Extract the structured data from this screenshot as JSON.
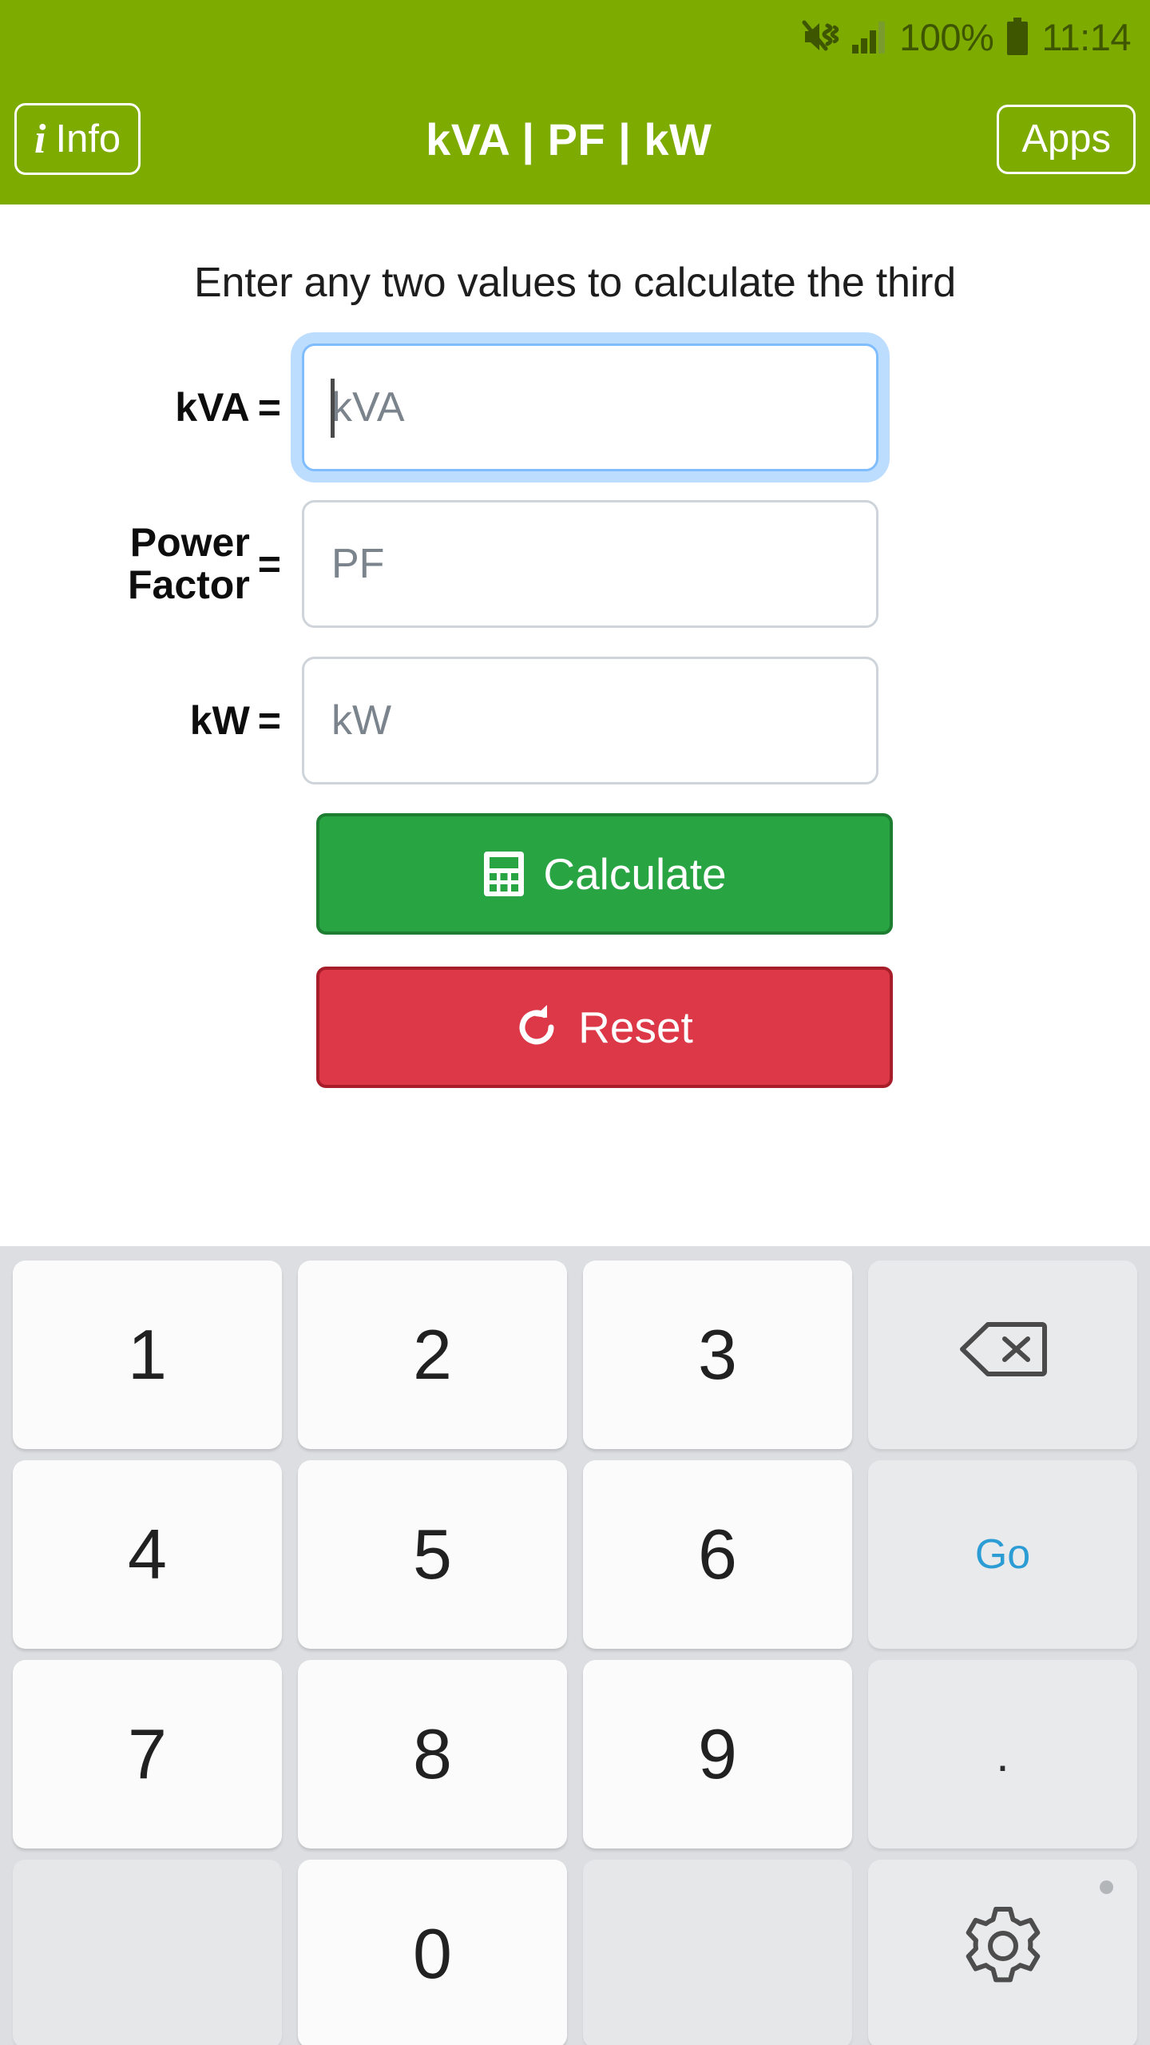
{
  "statusbar": {
    "mute_icon": "mute-vibrate-icon",
    "signal_icon": "signal-bars-icon",
    "battery_percent": "100%",
    "battery_icon": "battery-full-icon",
    "clock": "11:14"
  },
  "header": {
    "info_label": "Info",
    "info_icon": "info-italic-icon",
    "title": "kVA | PF | kW",
    "apps_label": "Apps",
    "brand_color": "#7dab00"
  },
  "main": {
    "hint": "Enter any two values to calculate the third",
    "fields": [
      {
        "label": "kVA",
        "equals": "=",
        "placeholder": "kVA",
        "value": "",
        "focused": true,
        "label_line2": ""
      },
      {
        "label": "Power",
        "label_line2": "Factor",
        "equals": "=",
        "placeholder": "PF",
        "value": "",
        "focused": false
      },
      {
        "label": "kW",
        "equals": "=",
        "placeholder": "kW",
        "value": "",
        "focused": false,
        "label_line2": ""
      }
    ],
    "calculate_label": "Calculate",
    "calculate_icon": "calculator-icon",
    "calculate_color": "#28a443",
    "reset_label": "Reset",
    "reset_icon": "refresh-circular-arrow-icon",
    "reset_color": "#dc3848"
  },
  "keyboard": {
    "rows": [
      [
        {
          "label": "1",
          "type": "num",
          "name": "key-1"
        },
        {
          "label": "2",
          "type": "num",
          "name": "key-2"
        },
        {
          "label": "3",
          "type": "num",
          "name": "key-3"
        },
        {
          "label": "",
          "type": "fn",
          "name": "key-backspace",
          "icon": "backspace-icon"
        }
      ],
      [
        {
          "label": "4",
          "type": "num",
          "name": "key-4"
        },
        {
          "label": "5",
          "type": "num",
          "name": "key-5"
        },
        {
          "label": "6",
          "type": "num",
          "name": "key-6"
        },
        {
          "label": "Go",
          "type": "go",
          "name": "key-go"
        }
      ],
      [
        {
          "label": "7",
          "type": "num",
          "name": "key-7"
        },
        {
          "label": "8",
          "type": "num",
          "name": "key-8"
        },
        {
          "label": "9",
          "type": "num",
          "name": "key-9"
        },
        {
          "label": ".",
          "type": "dot",
          "name": "key-period"
        }
      ],
      [
        {
          "label": "",
          "type": "blank",
          "name": "key-blank-left"
        },
        {
          "label": "0",
          "type": "num",
          "name": "key-0"
        },
        {
          "label": "",
          "type": "blank",
          "name": "key-blank-right"
        },
        {
          "label": "",
          "type": "fn",
          "name": "key-settings",
          "icon": "gear-icon",
          "badge": true
        }
      ]
    ],
    "go_color": "#2c9cd4",
    "background": "#dcdee1"
  }
}
